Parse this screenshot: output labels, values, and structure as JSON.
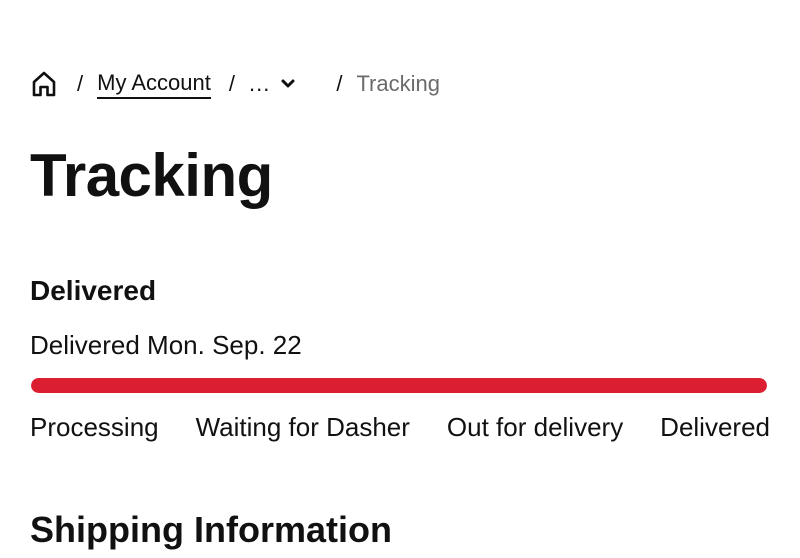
{
  "breadcrumb": {
    "home_icon": "home-icon",
    "separator": "/",
    "items": [
      {
        "label": "My Account"
      },
      {
        "label": "..."
      },
      {
        "label": "Tracking"
      }
    ],
    "dropdown_icon": "chevron-down-icon"
  },
  "page": {
    "title": "Tracking"
  },
  "status": {
    "heading": "Delivered",
    "date_text": "Delivered Mon. Sep. 22",
    "progress_percent": 100,
    "progress_color": "#dc1f30"
  },
  "steps": [
    {
      "label": "Processing"
    },
    {
      "label": "Waiting for Dasher"
    },
    {
      "label": "Out for delivery"
    },
    {
      "label": "Delivered"
    }
  ],
  "sections": {
    "shipping_title": "Shipping Information"
  }
}
